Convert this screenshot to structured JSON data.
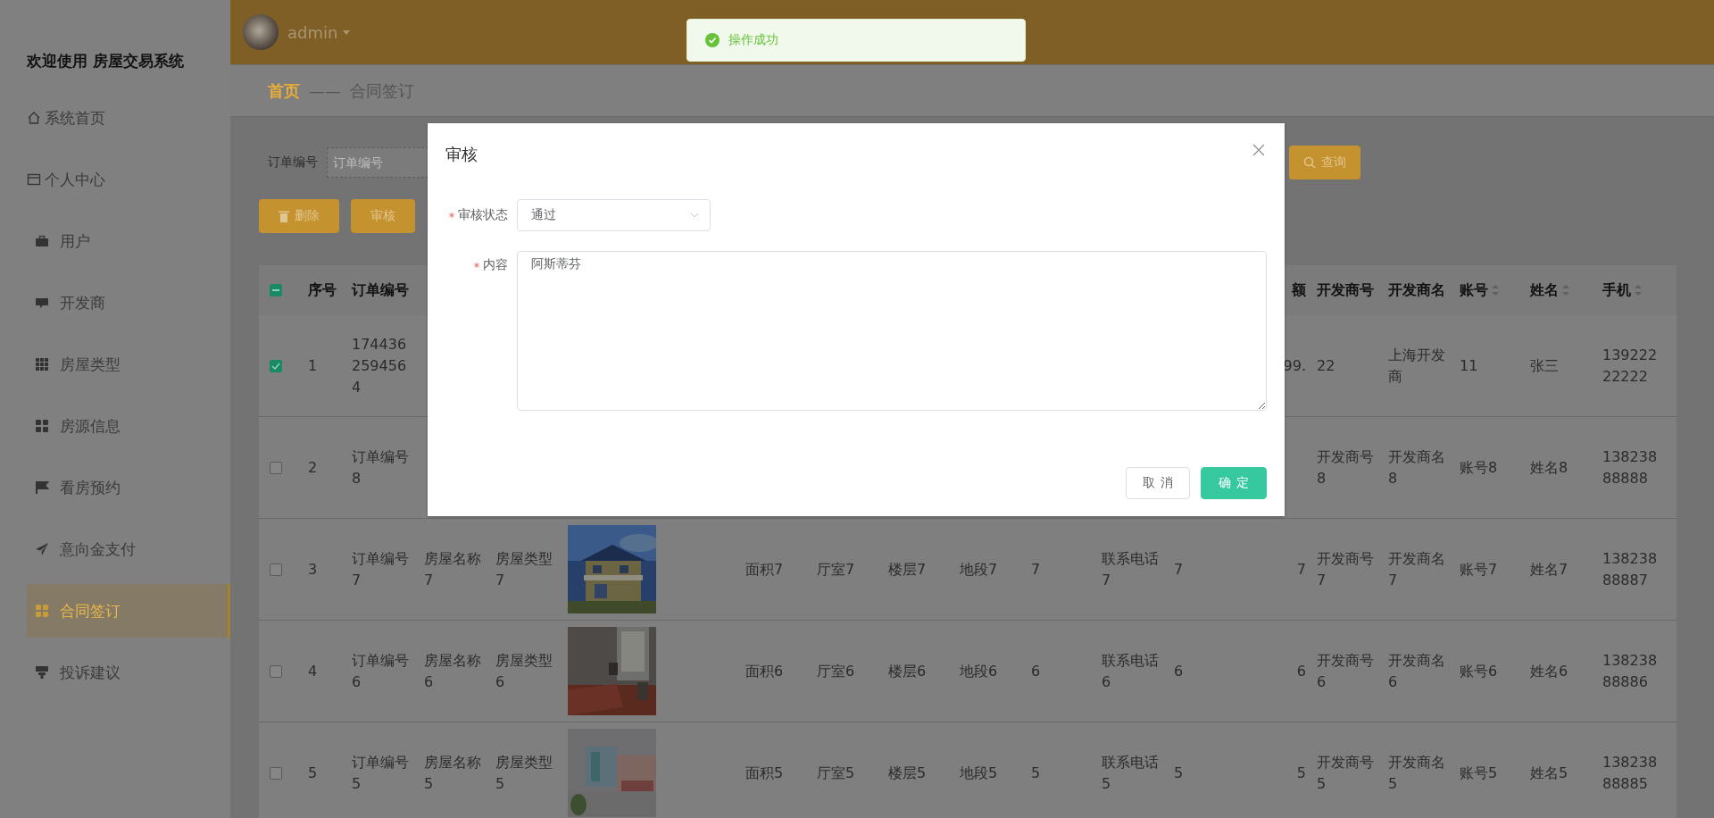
{
  "sidebar": {
    "title": "欢迎使用 房屋交易系统",
    "items": [
      {
        "label": "系统首页",
        "kind": "home",
        "selected": false
      },
      {
        "label": "个人中心",
        "kind": "card",
        "selected": false
      },
      {
        "label": "用户",
        "kind": "case",
        "selected": false
      },
      {
        "label": "开发商",
        "kind": "chat",
        "selected": false
      },
      {
        "label": "房屋类型",
        "kind": "grid9",
        "selected": false
      },
      {
        "label": "房源信息",
        "kind": "grid4",
        "selected": false
      },
      {
        "label": "看房预约",
        "kind": "flag",
        "selected": false
      },
      {
        "label": "意向金支付",
        "kind": "send",
        "selected": false
      },
      {
        "label": "合同签订",
        "kind": "grid4",
        "selected": true
      },
      {
        "label": "投诉建议",
        "kind": "stand",
        "selected": false
      }
    ]
  },
  "header": {
    "user": "admin"
  },
  "toast": {
    "message": "操作成功"
  },
  "breadcrumb": {
    "home": "首页",
    "separator": "——",
    "current": "合同签订"
  },
  "search": {
    "label": "订单编号",
    "placeholder": "订单编号",
    "button": "查询"
  },
  "actions": [
    {
      "label": "删除",
      "kind": "delete"
    },
    {
      "label": "审核",
      "kind": "plain"
    }
  ],
  "table": {
    "some_selected": true,
    "columns": [
      {
        "label": "序号"
      },
      {
        "label": "订单编号"
      },
      null,
      null,
      null,
      null,
      null,
      null,
      null,
      null,
      null,
      {
        "label": "额"
      },
      {
        "label": "开发商号"
      },
      {
        "label": "开发商名"
      },
      {
        "label": "账号",
        "sortable": true
      },
      {
        "label": "姓名",
        "sortable": true
      },
      {
        "label": "手机",
        "sortable": true
      }
    ],
    "rows": [
      {
        "selected": true,
        "cells": [
          "1",
          "1744362594564",
          null,
          null,
          null,
          null,
          null,
          null,
          null,
          null,
          null,
          "99.",
          "22",
          "上海开发商",
          "11",
          "张三",
          "13922222222"
        ]
      },
      {
        "selected": false,
        "cells": [
          "2",
          "订单编号8",
          null,
          null,
          null,
          null,
          null,
          null,
          null,
          null,
          null,
          null,
          "开发商号8",
          "开发商名8",
          "账号8",
          "姓名8",
          "13823888888"
        ]
      },
      {
        "selected": false,
        "cells": [
          "3",
          "订单编号7",
          "房屋名称7",
          "房屋类型7",
          "面积7",
          "厅室7",
          "楼层7",
          "地段7",
          "7",
          "联系电话7",
          "7",
          "7",
          "开发商号7",
          "开发商名7",
          "账号7",
          "姓名7",
          "13823888887"
        ]
      },
      {
        "selected": false,
        "cells": [
          "4",
          "订单编号6",
          "房屋名称6",
          "房屋类型6",
          "面积6",
          "厅室6",
          "楼层6",
          "地段6",
          "6",
          "联系电话6",
          "6",
          "6",
          "开发商号6",
          "开发商名6",
          "账号6",
          "姓名6",
          "13823888886"
        ]
      },
      {
        "selected": false,
        "cells": [
          "5",
          "订单编号5",
          "房屋名称5",
          "房屋类型5",
          "面积5",
          "厅室5",
          "楼层5",
          "地段5",
          "5",
          "联系电话5",
          "5",
          "5",
          "开发商号5",
          "开发商名5",
          "账号5",
          "姓名5",
          "13823888885"
        ]
      }
    ]
  },
  "dialog": {
    "title": "审核",
    "fields": [
      {
        "label": "审核状态",
        "required": true,
        "kind": "select",
        "value": "通过"
      },
      {
        "label": "内容",
        "required": true,
        "kind": "textarea",
        "value": "阿斯蒂芬"
      }
    ],
    "buttons": [
      {
        "label": "取消",
        "kind": "default"
      },
      {
        "label": "确定",
        "kind": "primary"
      }
    ]
  }
}
